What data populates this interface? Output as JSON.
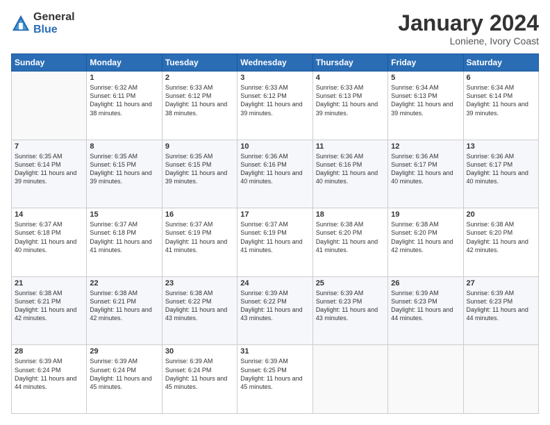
{
  "logo": {
    "general": "General",
    "blue": "Blue"
  },
  "header": {
    "title": "January 2024",
    "location": "Loniene, Ivory Coast"
  },
  "weekdays": [
    "Sunday",
    "Monday",
    "Tuesday",
    "Wednesday",
    "Thursday",
    "Friday",
    "Saturday"
  ],
  "weeks": [
    [
      {
        "day": "",
        "sunrise": "",
        "sunset": "",
        "daylight": ""
      },
      {
        "day": "1",
        "sunrise": "Sunrise: 6:32 AM",
        "sunset": "Sunset: 6:11 PM",
        "daylight": "Daylight: 11 hours and 38 minutes."
      },
      {
        "day": "2",
        "sunrise": "Sunrise: 6:33 AM",
        "sunset": "Sunset: 6:12 PM",
        "daylight": "Daylight: 11 hours and 38 minutes."
      },
      {
        "day": "3",
        "sunrise": "Sunrise: 6:33 AM",
        "sunset": "Sunset: 6:12 PM",
        "daylight": "Daylight: 11 hours and 39 minutes."
      },
      {
        "day": "4",
        "sunrise": "Sunrise: 6:33 AM",
        "sunset": "Sunset: 6:13 PM",
        "daylight": "Daylight: 11 hours and 39 minutes."
      },
      {
        "day": "5",
        "sunrise": "Sunrise: 6:34 AM",
        "sunset": "Sunset: 6:13 PM",
        "daylight": "Daylight: 11 hours and 39 minutes."
      },
      {
        "day": "6",
        "sunrise": "Sunrise: 6:34 AM",
        "sunset": "Sunset: 6:14 PM",
        "daylight": "Daylight: 11 hours and 39 minutes."
      }
    ],
    [
      {
        "day": "7",
        "sunrise": "Sunrise: 6:35 AM",
        "sunset": "Sunset: 6:14 PM",
        "daylight": "Daylight: 11 hours and 39 minutes."
      },
      {
        "day": "8",
        "sunrise": "Sunrise: 6:35 AM",
        "sunset": "Sunset: 6:15 PM",
        "daylight": "Daylight: 11 hours and 39 minutes."
      },
      {
        "day": "9",
        "sunrise": "Sunrise: 6:35 AM",
        "sunset": "Sunset: 6:15 PM",
        "daylight": "Daylight: 11 hours and 39 minutes."
      },
      {
        "day": "10",
        "sunrise": "Sunrise: 6:36 AM",
        "sunset": "Sunset: 6:16 PM",
        "daylight": "Daylight: 11 hours and 40 minutes."
      },
      {
        "day": "11",
        "sunrise": "Sunrise: 6:36 AM",
        "sunset": "Sunset: 6:16 PM",
        "daylight": "Daylight: 11 hours and 40 minutes."
      },
      {
        "day": "12",
        "sunrise": "Sunrise: 6:36 AM",
        "sunset": "Sunset: 6:17 PM",
        "daylight": "Daylight: 11 hours and 40 minutes."
      },
      {
        "day": "13",
        "sunrise": "Sunrise: 6:36 AM",
        "sunset": "Sunset: 6:17 PM",
        "daylight": "Daylight: 11 hours and 40 minutes."
      }
    ],
    [
      {
        "day": "14",
        "sunrise": "Sunrise: 6:37 AM",
        "sunset": "Sunset: 6:18 PM",
        "daylight": "Daylight: 11 hours and 40 minutes."
      },
      {
        "day": "15",
        "sunrise": "Sunrise: 6:37 AM",
        "sunset": "Sunset: 6:18 PM",
        "daylight": "Daylight: 11 hours and 41 minutes."
      },
      {
        "day": "16",
        "sunrise": "Sunrise: 6:37 AM",
        "sunset": "Sunset: 6:19 PM",
        "daylight": "Daylight: 11 hours and 41 minutes."
      },
      {
        "day": "17",
        "sunrise": "Sunrise: 6:37 AM",
        "sunset": "Sunset: 6:19 PM",
        "daylight": "Daylight: 11 hours and 41 minutes."
      },
      {
        "day": "18",
        "sunrise": "Sunrise: 6:38 AM",
        "sunset": "Sunset: 6:20 PM",
        "daylight": "Daylight: 11 hours and 41 minutes."
      },
      {
        "day": "19",
        "sunrise": "Sunrise: 6:38 AM",
        "sunset": "Sunset: 6:20 PM",
        "daylight": "Daylight: 11 hours and 42 minutes."
      },
      {
        "day": "20",
        "sunrise": "Sunrise: 6:38 AM",
        "sunset": "Sunset: 6:20 PM",
        "daylight": "Daylight: 11 hours and 42 minutes."
      }
    ],
    [
      {
        "day": "21",
        "sunrise": "Sunrise: 6:38 AM",
        "sunset": "Sunset: 6:21 PM",
        "daylight": "Daylight: 11 hours and 42 minutes."
      },
      {
        "day": "22",
        "sunrise": "Sunrise: 6:38 AM",
        "sunset": "Sunset: 6:21 PM",
        "daylight": "Daylight: 11 hours and 42 minutes."
      },
      {
        "day": "23",
        "sunrise": "Sunrise: 6:38 AM",
        "sunset": "Sunset: 6:22 PM",
        "daylight": "Daylight: 11 hours and 43 minutes."
      },
      {
        "day": "24",
        "sunrise": "Sunrise: 6:39 AM",
        "sunset": "Sunset: 6:22 PM",
        "daylight": "Daylight: 11 hours and 43 minutes."
      },
      {
        "day": "25",
        "sunrise": "Sunrise: 6:39 AM",
        "sunset": "Sunset: 6:23 PM",
        "daylight": "Daylight: 11 hours and 43 minutes."
      },
      {
        "day": "26",
        "sunrise": "Sunrise: 6:39 AM",
        "sunset": "Sunset: 6:23 PM",
        "daylight": "Daylight: 11 hours and 44 minutes."
      },
      {
        "day": "27",
        "sunrise": "Sunrise: 6:39 AM",
        "sunset": "Sunset: 6:23 PM",
        "daylight": "Daylight: 11 hours and 44 minutes."
      }
    ],
    [
      {
        "day": "28",
        "sunrise": "Sunrise: 6:39 AM",
        "sunset": "Sunset: 6:24 PM",
        "daylight": "Daylight: 11 hours and 44 minutes."
      },
      {
        "day": "29",
        "sunrise": "Sunrise: 6:39 AM",
        "sunset": "Sunset: 6:24 PM",
        "daylight": "Daylight: 11 hours and 45 minutes."
      },
      {
        "day": "30",
        "sunrise": "Sunrise: 6:39 AM",
        "sunset": "Sunset: 6:24 PM",
        "daylight": "Daylight: 11 hours and 45 minutes."
      },
      {
        "day": "31",
        "sunrise": "Sunrise: 6:39 AM",
        "sunset": "Sunset: 6:25 PM",
        "daylight": "Daylight: 11 hours and 45 minutes."
      },
      {
        "day": "",
        "sunrise": "",
        "sunset": "",
        "daylight": ""
      },
      {
        "day": "",
        "sunrise": "",
        "sunset": "",
        "daylight": ""
      },
      {
        "day": "",
        "sunrise": "",
        "sunset": "",
        "daylight": ""
      }
    ]
  ]
}
